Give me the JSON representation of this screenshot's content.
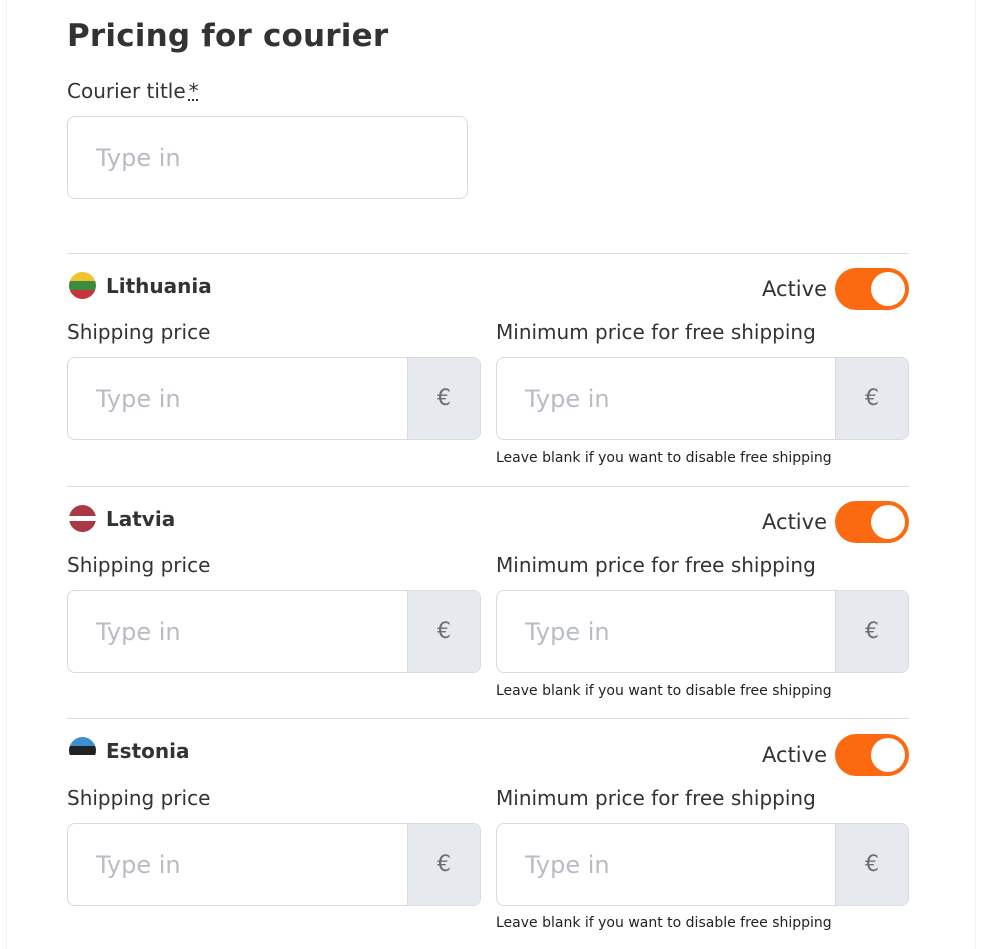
{
  "page": {
    "title": "Pricing for courier",
    "courier_title_label": "Courier title",
    "required_mark": "*",
    "courier_title_placeholder": "Type in"
  },
  "colors": {
    "accent": "#fb6a10",
    "addon_background": "#e6e9ee",
    "border": "#d9dadf"
  },
  "countries": [
    {
      "name": "Lithuania",
      "flag_icon": "lithuania-flag-icon",
      "active_label": "Active",
      "active": true,
      "shipping_label": "Shipping price",
      "shipping_placeholder": "Type in",
      "currency": "€",
      "min_label": "Minimum price for free shipping",
      "min_placeholder": "Type in",
      "hint": "Leave blank if you want to disable free shipping"
    },
    {
      "name": "Latvia",
      "flag_icon": "latvia-flag-icon",
      "active_label": "Active",
      "active": true,
      "shipping_label": "Shipping price",
      "shipping_placeholder": "Type in",
      "currency": "€",
      "min_label": "Minimum price for free shipping",
      "min_placeholder": "Type in",
      "hint": "Leave blank if you want to disable free shipping"
    },
    {
      "name": "Estonia",
      "flag_icon": "estonia-flag-icon",
      "active_label": "Active",
      "active": true,
      "shipping_label": "Shipping price",
      "shipping_placeholder": "Type in",
      "currency": "€",
      "min_label": "Minimum price for free shipping",
      "min_placeholder": "Type in",
      "hint": "Leave blank if you want to disable free shipping"
    }
  ]
}
